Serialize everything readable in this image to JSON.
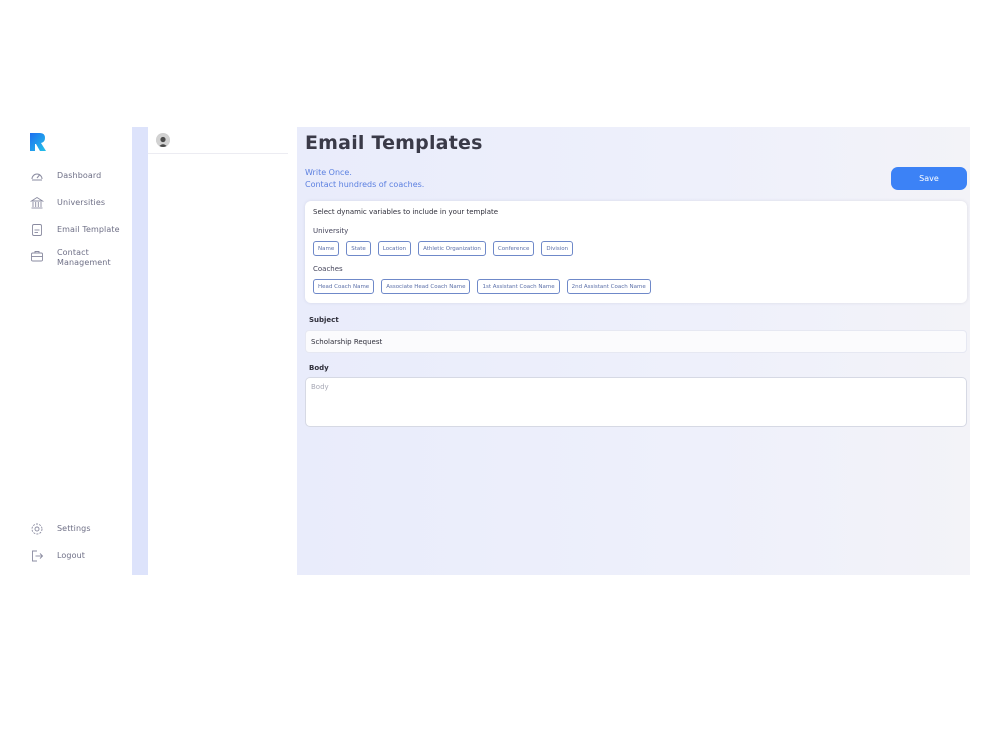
{
  "colors": {
    "accent": "#3c82f6",
    "tagline": "#5b7fe0",
    "chip_border": "#6f89c9",
    "strip": "#dde3fb"
  },
  "nav": {
    "logo_icon": "r-logo-icon",
    "items": [
      {
        "label": "Dashboard",
        "icon": "gauge-icon"
      },
      {
        "label": "Universities",
        "icon": "bank-icon"
      },
      {
        "label": "Email Template",
        "icon": "document-icon"
      },
      {
        "label": "Contact Management",
        "icon": "briefcase-icon"
      }
    ],
    "bottom": [
      {
        "label": "Settings",
        "icon": "gear-icon"
      },
      {
        "label": "Logout",
        "icon": "logout-icon"
      }
    ]
  },
  "main": {
    "title": "Email Templates",
    "tagline_line1": "Write Once.",
    "tagline_line2": "Contact hundreds of coaches.",
    "save_label": "Save"
  },
  "variables": {
    "heading": "Select dynamic variables to include in your template",
    "university_label": "University",
    "university_chips": [
      "Name",
      "State",
      "Location",
      "Athletic Organization",
      "Conference",
      "Division"
    ],
    "coaches_label": "Coaches",
    "coaches_chips": [
      "Head Coach Name",
      "Associate Head Coach Name",
      "1st Assistant Coach Name",
      "2nd Assistant Coach Name"
    ]
  },
  "form": {
    "subject_label": "Subject",
    "subject_value": "Scholarship Request",
    "body_label": "Body",
    "body_placeholder": "Body"
  }
}
